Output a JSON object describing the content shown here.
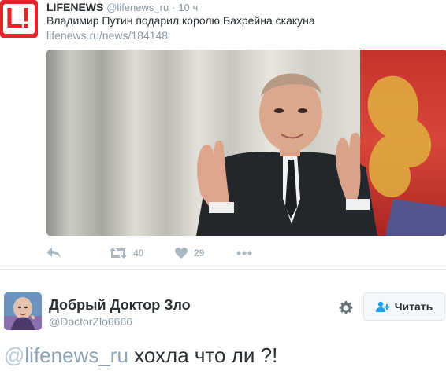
{
  "quoted_tweet": {
    "author_name": "LIFENEWS",
    "author_handle": "@lifenews_ru",
    "separator": "·",
    "time": "10 ч",
    "text": "Владимир Путин подарил королю Бахрейна скакуна",
    "link": "lifenews.ru/news/184148",
    "avatar_letter": "L!",
    "actions": {
      "reply_icon": "reply-icon",
      "retweet_icon": "retweet-icon",
      "retweet_count": "40",
      "like_icon": "heart-icon",
      "like_count": "29",
      "more_icon": "more-dots-icon"
    }
  },
  "main_tweet": {
    "display_name": "Добрый Доктор Зло",
    "screen_name": "@DoctorZlo6666",
    "follow_label": "Читать",
    "text": {
      "mention_at": "@",
      "mention_name": "lifenews_ru",
      "body": " хохла что ли ?!"
    }
  },
  "colors": {
    "brand_red": "#e3242b",
    "text": "#292f33",
    "muted": "#8899a6",
    "divider": "#e1e8ed",
    "action_gray": "#aab8c2"
  }
}
